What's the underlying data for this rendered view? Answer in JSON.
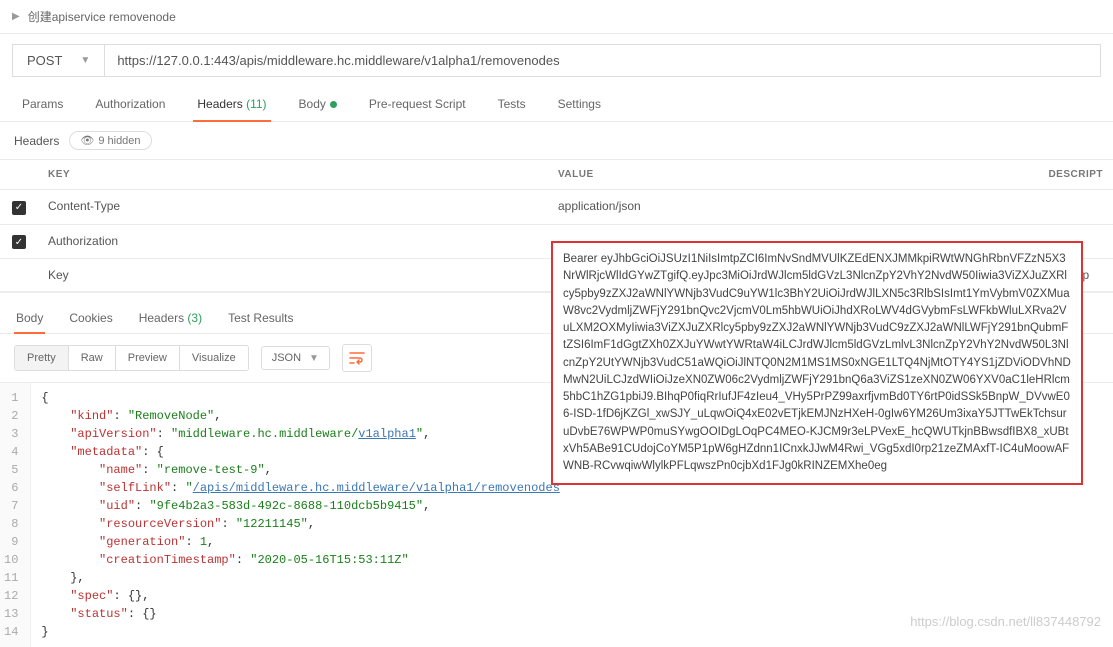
{
  "top": {
    "title": "创建apiservice removenode"
  },
  "request": {
    "method": "POST",
    "url": "https://127.0.0.1:443/apis/middleware.hc.middleware/v1alpha1/removenodes"
  },
  "tabs": {
    "params": "Params",
    "auth": "Authorization",
    "headers_label": "Headers",
    "headers_count": "(11)",
    "body": "Body",
    "prerequest": "Pre-request Script",
    "tests": "Tests",
    "settings": "Settings"
  },
  "headers_section": {
    "title": "Headers",
    "hidden_label": "9 hidden",
    "cols": {
      "key": "KEY",
      "value": "VALUE",
      "desc": "DESCRIPT"
    },
    "rows": [
      {
        "key": "Content-Type",
        "value": "application/json"
      },
      {
        "key": "Authorization",
        "value": "Bearer eyJhbGciOiJSUzI1NiIsImtpZCI6ImNvSndMVUlKZEdENXJMMkpiRWtWNGhRbnVFZzN5X3NrWlRjcWlIdGYwZTgifQ.eyJpc3MiOiJrdWJlcm5ldGVzL3NlcnZpY2VhY2NvdW50Iiwia3ViZXJuZXRlcy5pby9zZXJ2aWNlYWNjb3VudC9uYW1lc3BhY2UiOiJrdWJlLXN5c3RlbSIsImt1YmVybmV0ZXMuaW8vc2VydmljZWFjY291bnQvc2VjcmV0Lm5hbWUiOiJhdXRoLWV4dGVybmFsLWFkbWluLXRva2VuLXM2OXMyIiwia3ViZXJuZXRlcy5pby9zZXJ2aWNlYWNjb3VudC9zZXJ2aWNlLWFjY291bnQubmFtZSI6ImF1dGgtZXh0ZXJuYWwtYWRtaW4iLCJrdWJlcm5ldGVzLmlvL3NlcnZpY2VhY2NvdW50L3NlcnZpY2UtYWNjb3VudC51aWQiOiJlNTQ0N2M1MS1MS0xNGE1LTQ4NjMtOTY4YS1jZDViODVhNDMwN2UiLCJzdWIiOiJzeXN0ZW06c2VydmljZWFjY291bnQ6a3ViZS1zeXN0ZW06YXV0aC1leHRlcm5hbC1hZG1pbiJ9.BIhqP0fiqRrIufJF4zIeu4_VHy5PrPZ99axrfjvmBd0TY6rtP0idSSk5BnpW_DVvwE06-ISD-1fD6jKZGl_xwSJY_uLqwOiQ4xE02vETjkEMJNzHXeH-0gIw6YM26Um3ixaY5JTTwEkTchsuruDvbE76WPWP0muSYwgOOIDgLOqPC4MEO-KJCM9r3eLPVexE_hcQWUTkjnBBwsdfIBX8_xUBtxVh5ABe91CUdojCoYM5P1pW6gHZdnn1ICnxkJJwM4Rwi_VGg5xdI0rp21zeZMAxfT-IC4uMoowAFWNB-RCvwqiwWlylkPFLqwszPn0cjbXd1FJg0kRINZEMXhe0eg"
      }
    ],
    "key_placeholder": "Key",
    "desc_placeholder": "Descrip"
  },
  "response_tabs": {
    "body": "Body",
    "cookies": "Cookies",
    "headers_label": "Headers",
    "headers_count": "(3)",
    "test_results": "Test Results"
  },
  "toolbar": {
    "pretty": "Pretty",
    "raw": "Raw",
    "preview": "Preview",
    "visualize": "Visualize",
    "format": "JSON"
  },
  "code": {
    "lines": [
      "1",
      "2",
      "3",
      "4",
      "5",
      "6",
      "7",
      "8",
      "9",
      "10",
      "11",
      "12",
      "13",
      "14"
    ],
    "json": {
      "kind": "RemoveNode",
      "apiVersion_pre": "middleware.hc.middleware/",
      "apiVersion_link": "v1alpha1",
      "metadata": {
        "name": "remove-test-9",
        "selfLink_pre": "/apis/middleware.hc.middleware/v1alpha1/removenodes",
        "uid": "9fe4b2a3-583d-492c-8688-110dcb5b9415",
        "resourceVersion": "12211145",
        "generation": "1",
        "creationTimestamp": "2020-05-16T15:53:11Z"
      }
    }
  },
  "watermark": "https://blog.csdn.net/ll837448792"
}
